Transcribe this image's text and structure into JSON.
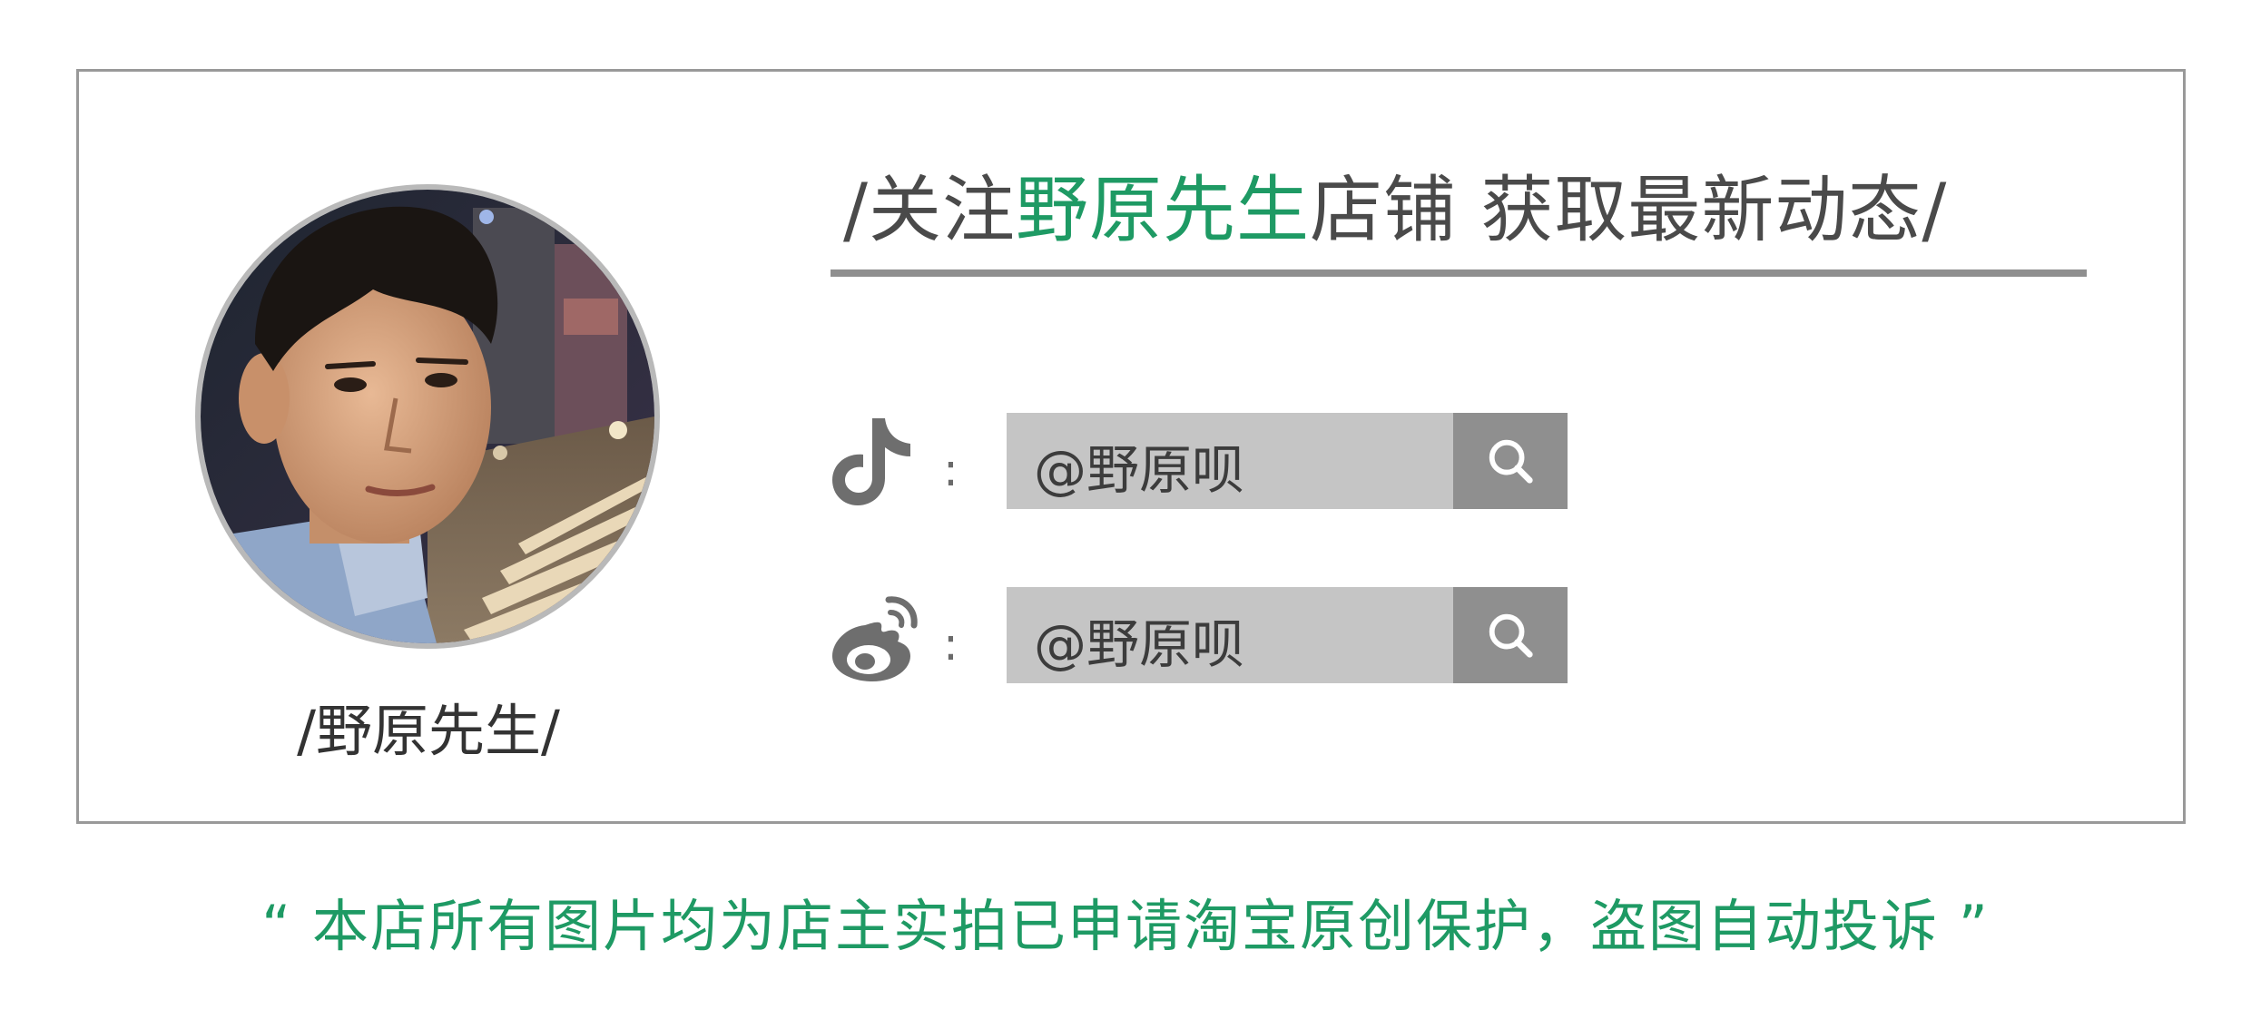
{
  "profile": {
    "caption": "/野原先生/"
  },
  "headline": {
    "prefix": "/关注",
    "accent": "野原先生",
    "suffix": "店铺 获取最新动态/",
    "accent_color": "#1e9a64"
  },
  "social": [
    {
      "platform_icon": "douyin-icon",
      "separator": ":",
      "handle": "@野原呗",
      "action_icon": "search-icon"
    },
    {
      "platform_icon": "weibo-icon",
      "separator": ":",
      "handle": "@野原呗",
      "action_icon": "search-icon"
    }
  ],
  "notice": {
    "text": "“ 本店所有图片均为店主实拍已申请淘宝原创保护，盗图自动投诉 ”",
    "color": "#1e9a64"
  }
}
